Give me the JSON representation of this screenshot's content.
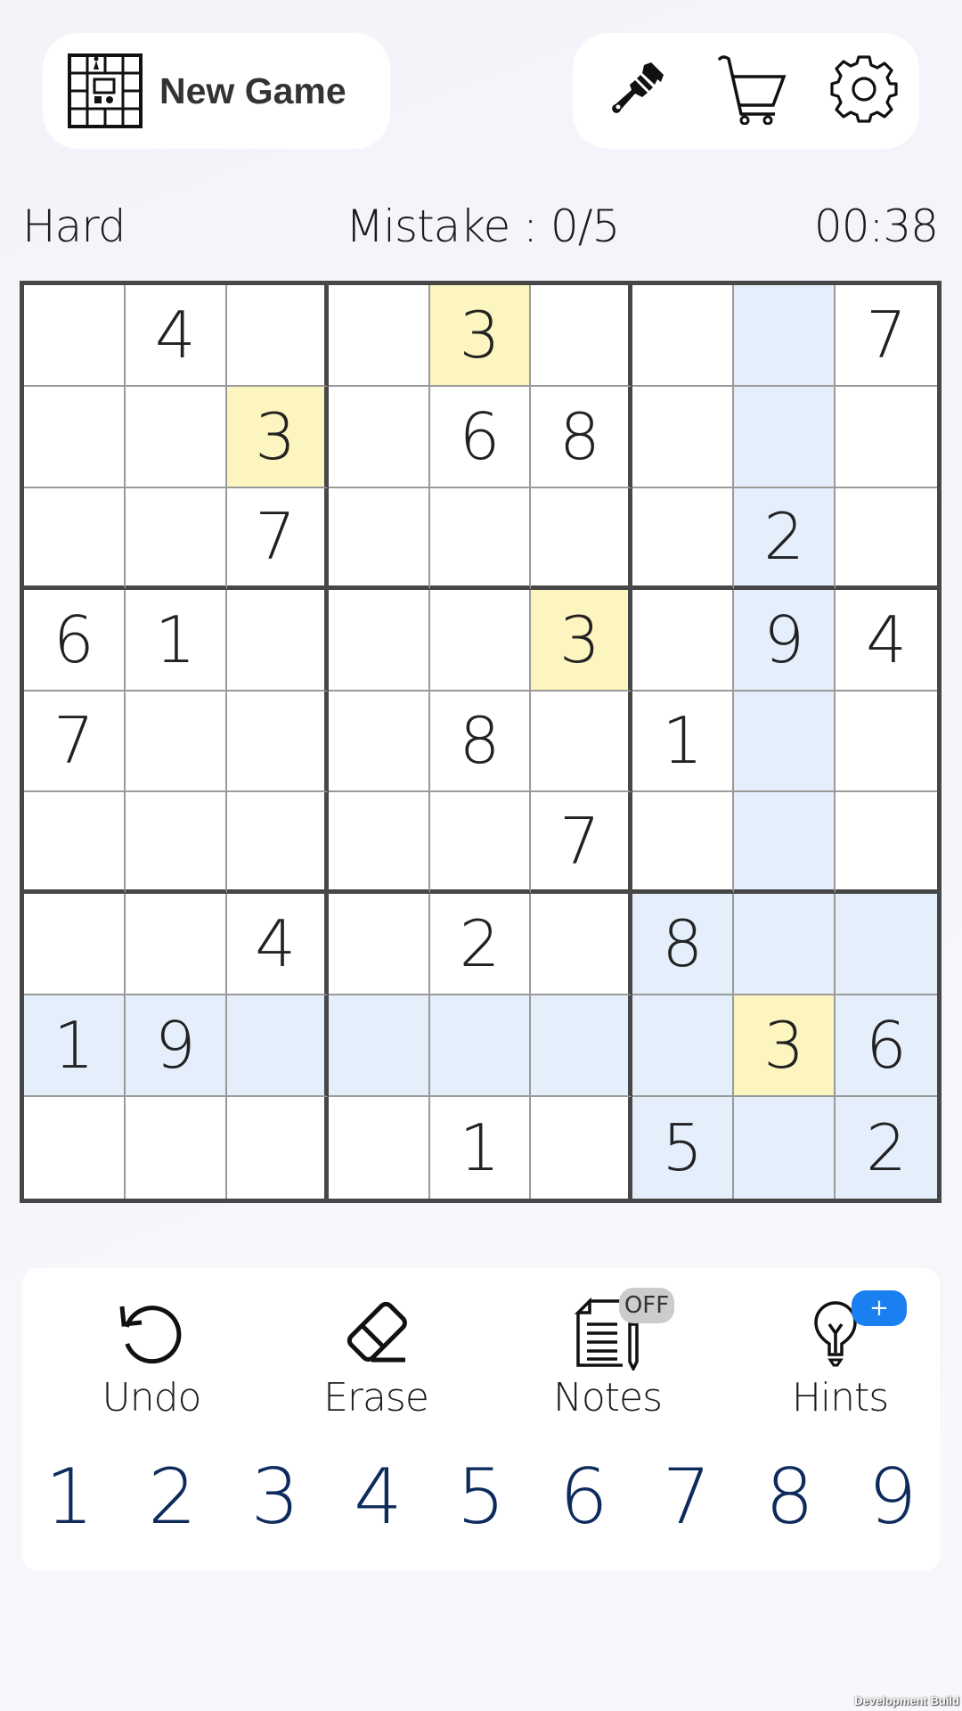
{
  "header": {
    "new_game_label": "New Game",
    "icons": [
      "grid-board-icon",
      "paintbrush-icon",
      "cart-icon",
      "gear-icon"
    ]
  },
  "status": {
    "difficulty": "Hard",
    "mistakes": "Mistake : 0/5",
    "timer": "00:38"
  },
  "board": {
    "rows": [
      [
        "",
        "4",
        "",
        "",
        "3",
        "",
        "",
        "",
        "7"
      ],
      [
        "",
        "",
        "3",
        "",
        "6",
        "8",
        "",
        "",
        ""
      ],
      [
        "",
        "",
        "7",
        "",
        "",
        "",
        "",
        "2",
        ""
      ],
      [
        "6",
        "1",
        "",
        "",
        "",
        "3",
        "",
        "9",
        "4"
      ],
      [
        "7",
        "",
        "",
        "",
        "8",
        "",
        "1",
        "",
        ""
      ],
      [
        "",
        "",
        "",
        "",
        "",
        "7",
        "",
        "",
        ""
      ],
      [
        "",
        "",
        "4",
        "",
        "2",
        "",
        "8",
        "",
        ""
      ],
      [
        "1",
        "9",
        "",
        "",
        "",
        "",
        "",
        "3",
        "6"
      ],
      [
        "",
        "",
        "",
        "",
        "1",
        "",
        "5",
        "",
        "2"
      ]
    ],
    "selected": {
      "row": 8,
      "col": 8
    },
    "highlight_value": "3",
    "colors": {
      "related": "#e5effc",
      "same_value": "#fdf5bf",
      "border": "#474747",
      "digit": "#222222"
    }
  },
  "actions": {
    "undo": "Undo",
    "erase": "Erase",
    "notes": "Notes",
    "notes_badge": "OFF",
    "hints": "Hints",
    "hints_badge": "+"
  },
  "numpad": {
    "digits": [
      "1",
      "2",
      "3",
      "4",
      "5",
      "6",
      "7",
      "8",
      "9"
    ],
    "color": "#0d2b5c"
  },
  "watermark": "Development Build"
}
